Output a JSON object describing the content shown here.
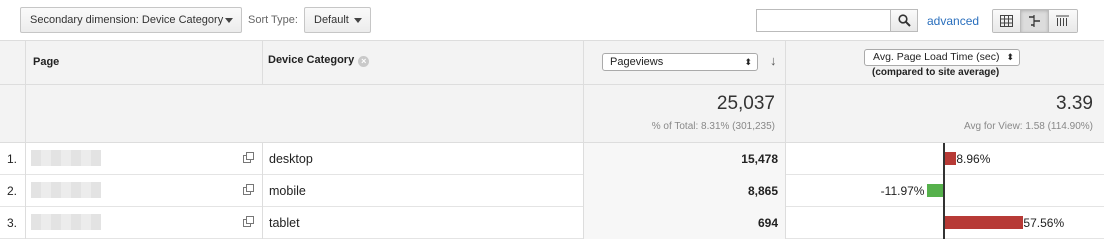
{
  "toolbar": {
    "secondary_dimension": "Secondary dimension: Device Category",
    "sort_type_label": "Sort Type:",
    "sort_type_value": "Default",
    "search_placeholder": "",
    "advanced_link": "advanced",
    "view_icons": [
      "data-table-icon",
      "comparison-icon",
      "term-cloud-icon"
    ]
  },
  "table": {
    "headers": {
      "page": "Page",
      "device_category": "Device Category",
      "metric": "Pageviews",
      "comparison_metric": "Avg. Page Load Time (sec)",
      "comparison_sub": "(compared to site average)"
    },
    "summary": {
      "pageviews": "25,037",
      "pageviews_sub": "% of Total: 8.31% (301,235)",
      "load_time": "3.39",
      "load_time_sub": "Avg for View: 1.58 (114.90%)"
    },
    "rows": [
      {
        "index": "1.",
        "device": "desktop",
        "pageviews": "15,478",
        "pct_label": "8.96%",
        "pct": 8.96
      },
      {
        "index": "2.",
        "device": "mobile",
        "pageviews": "8,865",
        "pct_label": "-11.97%",
        "pct": -11.97
      },
      {
        "index": "3.",
        "device": "tablet",
        "pageviews": "694",
        "pct_label": "57.56%",
        "pct": 57.56
      }
    ]
  },
  "colors": {
    "positive_bar": "#b73a36",
    "negative_bar": "#56b14c",
    "link": "#2a6fbd"
  }
}
